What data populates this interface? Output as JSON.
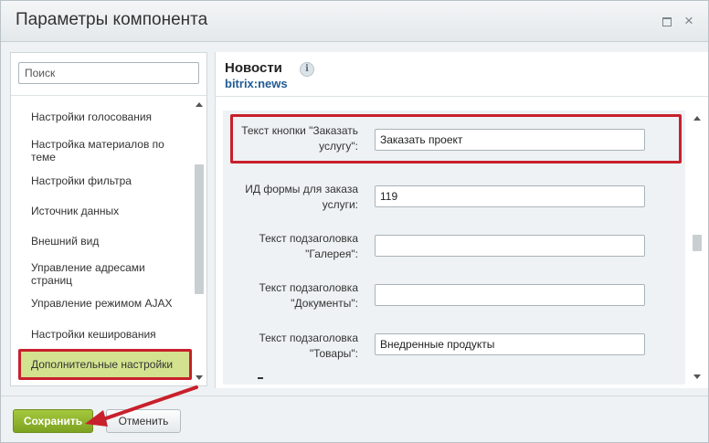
{
  "dialog": {
    "title": "Параметры компонента",
    "maximize_icon": "maximize-icon",
    "close_icon": "close-icon",
    "close_glyph": "×"
  },
  "sidebar": {
    "search_placeholder": "Поиск",
    "items": [
      {
        "label": "Настройки голосования"
      },
      {
        "label": "Настройка материалов по теме"
      },
      {
        "label": "Настройки фильтра"
      },
      {
        "label": "Источник данных"
      },
      {
        "label": "Внешний вид"
      },
      {
        "label": "Управление адресами страниц"
      },
      {
        "label": "Управление режимом AJAX"
      },
      {
        "label": "Настройки кеширования"
      },
      {
        "label": "Дополнительные настройки",
        "active": true
      }
    ]
  },
  "component": {
    "title": "Новости",
    "info_icon": "info-icon",
    "info_glyph": "i",
    "code": "bitrix:news"
  },
  "form": {
    "fields": [
      {
        "label": "Текст кнопки \"Заказать услугу\":",
        "value": "Заказать проект",
        "highlighted": true
      },
      {
        "label": "ИД формы для заказа услуги:",
        "value": "119"
      },
      {
        "label": "Текст подзаголовка \"Галерея\":",
        "value": ""
      },
      {
        "label": "Текст подзаголовка \"Документы\":",
        "value": ""
      },
      {
        "label": "Текст подзаголовка \"Товары\":",
        "value": "Внедренные продукты"
      }
    ]
  },
  "footer": {
    "save_label": "Сохранить",
    "cancel_label": "Отменить"
  },
  "colors": {
    "highlight_border": "#c8202c",
    "save_green": "#8cb02c",
    "active_item_bg": "#d3e28f",
    "link_blue": "#215c95"
  }
}
